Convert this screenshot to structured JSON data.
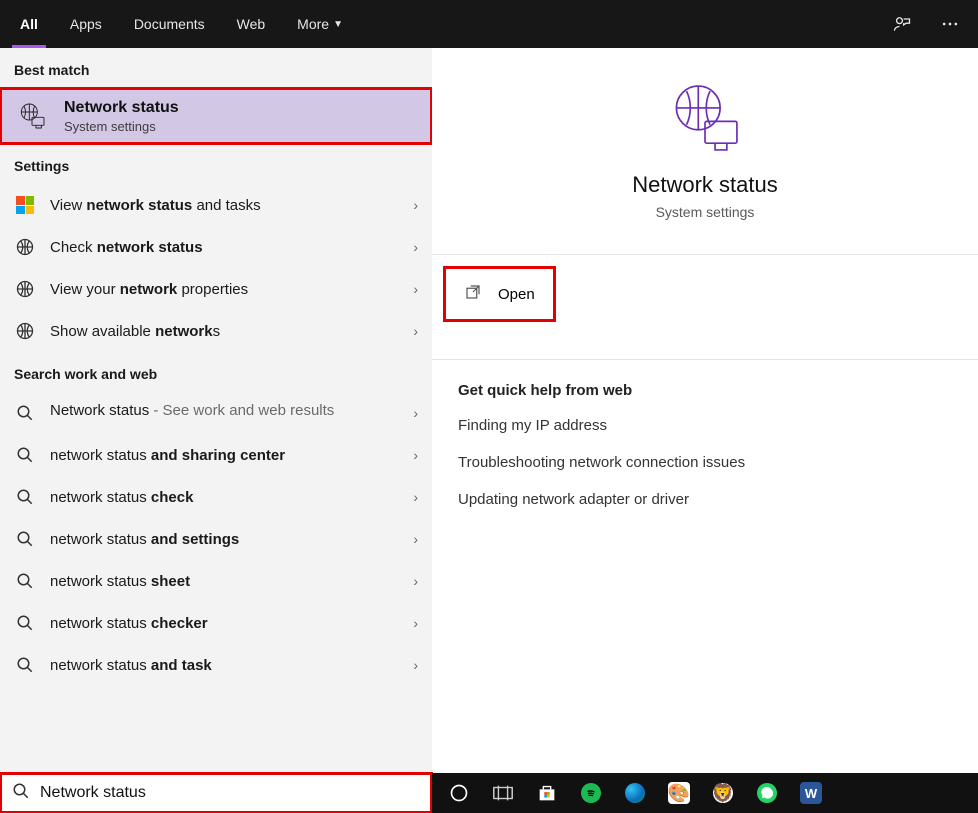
{
  "topbar": {
    "tabs": [
      "All",
      "Apps",
      "Documents",
      "Web",
      "More"
    ],
    "active_index": 0
  },
  "left": {
    "best_match_header": "Best match",
    "best_match": {
      "title": "Network status",
      "subtitle": "System settings"
    },
    "settings_header": "Settings",
    "settings": [
      {
        "pre": "View ",
        "bold": "network status",
        "post": " and tasks"
      },
      {
        "pre": "Check ",
        "bold": "network status",
        "post": ""
      },
      {
        "pre": "View your ",
        "bold": "network",
        "post": " properties"
      },
      {
        "pre": "Show available ",
        "bold": "network",
        "post": "s"
      }
    ],
    "search_header": "Search work and web",
    "search": [
      {
        "main": "Network status",
        "suffix": " - See work and web results"
      },
      {
        "main": "network status ",
        "bold": "and sharing center"
      },
      {
        "main": "network status ",
        "bold": "check"
      },
      {
        "main": "network status ",
        "bold": "and settings"
      },
      {
        "main": "network status ",
        "bold": "sheet"
      },
      {
        "main": "network status ",
        "bold": "checker"
      },
      {
        "main": "network status ",
        "bold": "and task"
      }
    ]
  },
  "right": {
    "title": "Network status",
    "subtitle": "System settings",
    "open_label": "Open",
    "help_header": "Get quick help from web",
    "help_links": [
      "Finding my IP address",
      "Troubleshooting network connection issues",
      "Updating network adapter or driver"
    ]
  },
  "search_value": "Network status"
}
